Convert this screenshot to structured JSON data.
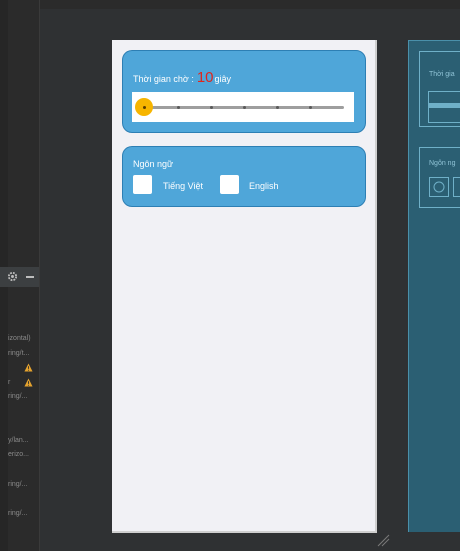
{
  "left_panel": {
    "lines": [
      {
        "text": "izontal)"
      },
      {
        "text": "ring/t..."
      },
      {
        "text": "r"
      },
      {
        "text": "ring/..."
      },
      {
        "text": "y/lan..."
      },
      {
        "text": "erizo..."
      },
      {
        "text": "ring/..."
      },
      {
        "text": "ring/..."
      }
    ]
  },
  "settings": {
    "timeout": {
      "label": "Thời gian chờ :",
      "value": "10",
      "unit": "giây",
      "slider_level": 0
    },
    "language": {
      "title": "Ngôn ngữ",
      "options": [
        {
          "label": "Tiếng Việt"
        },
        {
          "label": "English"
        }
      ]
    }
  },
  "blueprint": {
    "timeout_label": "Thời gia",
    "lang_title": "Ngôn ng"
  },
  "colors": {
    "card": "#4fa6d9",
    "value": "#e0261b",
    "thumb": "#f7b500",
    "blueprint": "#2b5f73"
  }
}
